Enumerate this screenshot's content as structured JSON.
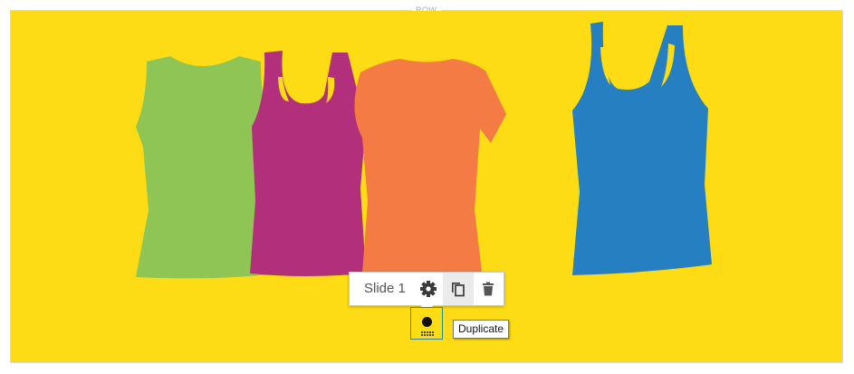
{
  "row": {
    "label": "ROW"
  },
  "slide": {
    "name": "Slide 1",
    "image_description": "",
    "background_color": "#fedc15"
  },
  "toolbar": {
    "items": [
      {
        "icon": "gear-icon"
      },
      {
        "icon": "duplicate-icon"
      },
      {
        "icon": "trash-icon"
      }
    ]
  },
  "tooltip": {
    "text": "Duplicate"
  },
  "colors": {
    "green_shirt": "#8fc554",
    "magenta_shirt": "#b2307b",
    "orange_shirt": "#f57b45",
    "blue_shirt": "#257fc0",
    "selection_border": "#2a8a8a"
  }
}
